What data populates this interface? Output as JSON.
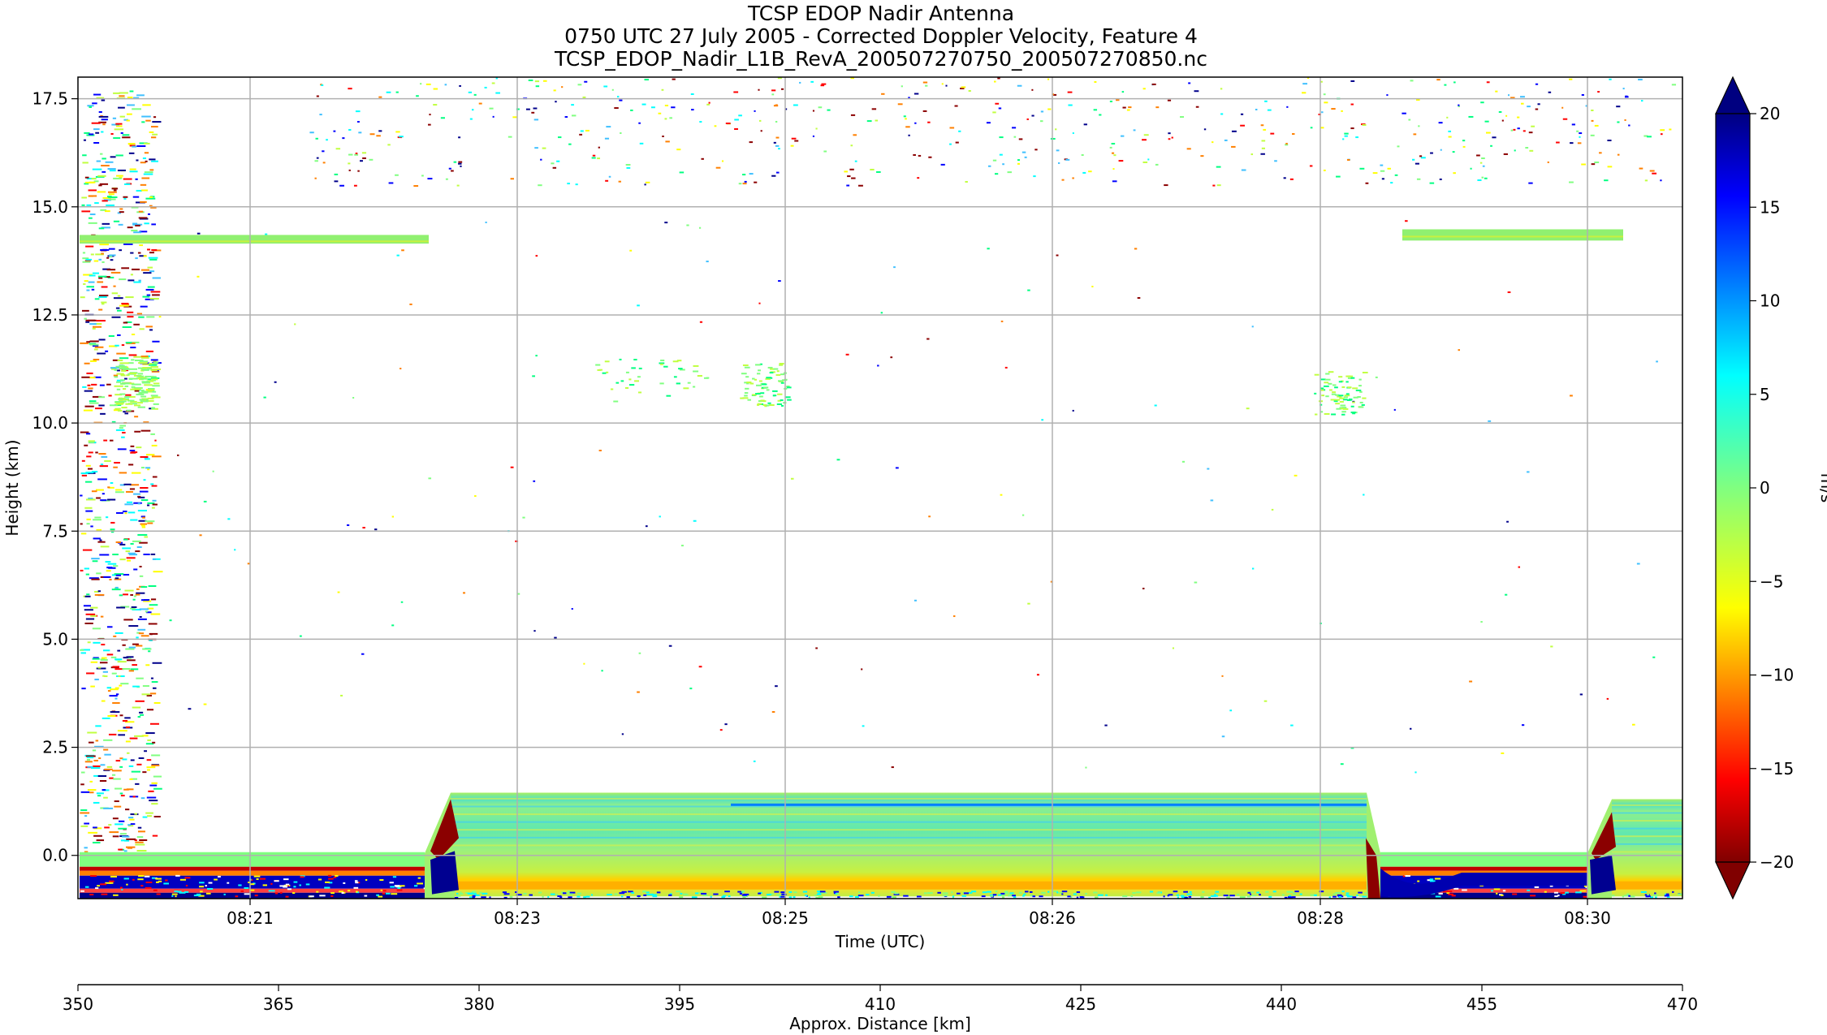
{
  "chart_data": {
    "type": "heatmap",
    "title_lines": [
      "TCSP EDOP Nadir Antenna",
      "0750 UTC 27 July 2005 - Corrected Doppler Velocity, Feature 4",
      "TCSP_EDOP_Nadir_L1B_RevA_200507270750_200507270850.nc"
    ],
    "xlabel": "Time (UTC)",
    "ylabel": "Height (km)",
    "x_ticks": [
      "08:21",
      "08:23",
      "08:25",
      "08:26",
      "08:28",
      "08:30"
    ],
    "y_ticks": [
      "17.5",
      "15.0",
      "12.5",
      "10.0",
      "7.5",
      "5.0",
      "2.5",
      "0.0"
    ],
    "ylim": [
      -1.0,
      18.0
    ],
    "grid": true,
    "secondary_x": {
      "label": "Approx. Distance [km]",
      "ticks": [
        350,
        365,
        380,
        395,
        410,
        425,
        440,
        455,
        470
      ],
      "range": [
        350,
        470
      ]
    },
    "colorbar": {
      "label": "m/s",
      "ticks": [
        "20",
        "15",
        "10",
        "5",
        "0",
        "−5",
        "−10",
        "−15",
        "−20"
      ],
      "range": [
        -20,
        20
      ],
      "colormap": "jet_r",
      "extend": "both"
    },
    "features": [
      {
        "kind": "sea-surface-echo",
        "height_km": [
          -1.0,
          0.0
        ],
        "velocity_ms": "strong ± (dark red / dark blue bands)"
      },
      {
        "kind": "cirrus-layer",
        "height_km": [
          14.2,
          14.4
        ],
        "velocity_ms": [
          -2,
          0
        ]
      },
      {
        "kind": "cirrus-layer",
        "height_km": [
          14.3,
          14.5
        ],
        "velocity_ms": [
          -2,
          0
        ]
      },
      {
        "kind": "low-echo-block",
        "height_km": [
          -1.0,
          1.5
        ],
        "velocity_ms": [
          -8,
          8
        ]
      },
      {
        "kind": "low-echo-block",
        "height_km": [
          -1.0,
          1.3
        ],
        "velocity_ms": [
          -8,
          8
        ]
      }
    ]
  }
}
